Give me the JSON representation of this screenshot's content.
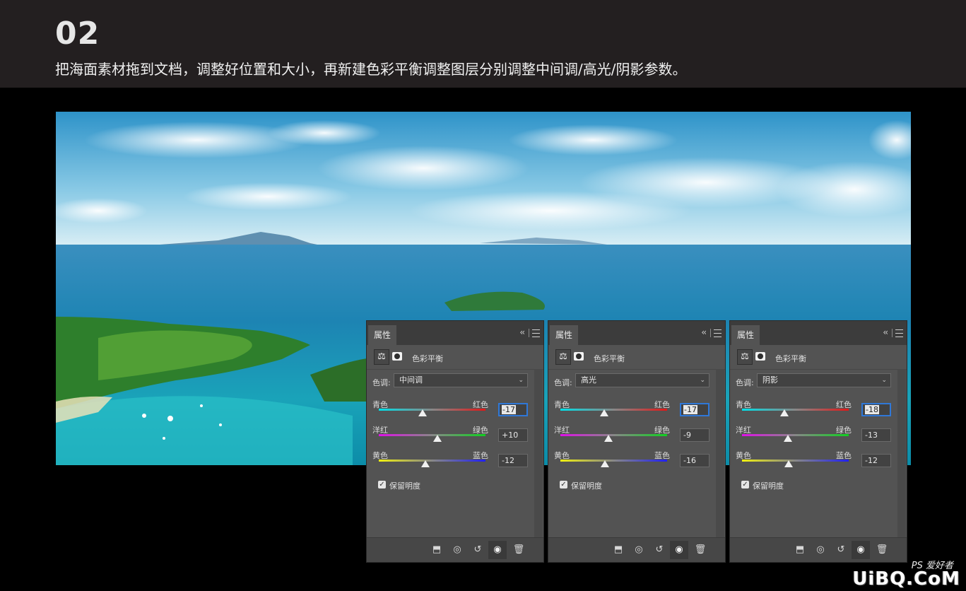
{
  "header": {
    "step": "02",
    "description": "把海面素材拖到文档，调整好位置和大小，再新建色彩平衡调整图层分别调整中间调/高光/阴影参数。"
  },
  "panels": [
    {
      "tab": "属性",
      "collapse": "‹‹",
      "adjustment": "色彩平衡",
      "tone_label": "色调:",
      "tone": "中间调",
      "sliders": [
        {
          "left": "青色",
          "right": "红色",
          "value": "-17",
          "level": 0.41
        },
        {
          "left": "洋红",
          "right": "绿色",
          "value": "+10",
          "level": 0.55
        },
        {
          "left": "黄色",
          "right": "蓝色",
          "value": "-12",
          "level": 0.44
        }
      ],
      "preserve_label": "保留明度",
      "preserve_checked": true
    },
    {
      "tab": "属性",
      "collapse": "‹‹",
      "adjustment": "色彩平衡",
      "tone_label": "色调:",
      "tone": "高光",
      "sliders": [
        {
          "left": "青色",
          "right": "红色",
          "value": "-17",
          "level": 0.41
        },
        {
          "left": "洋红",
          "right": "绿色",
          "value": "-9",
          "level": 0.45
        },
        {
          "left": "黄色",
          "right": "蓝色",
          "value": "-16",
          "level": 0.42
        }
      ],
      "preserve_label": "保留明度",
      "preserve_checked": true
    },
    {
      "tab": "属性",
      "collapse": "‹‹",
      "adjustment": "色彩平衡",
      "tone_label": "色调:",
      "tone": "阴影",
      "sliders": [
        {
          "left": "青色",
          "right": "红色",
          "value": "-18",
          "level": 0.4
        },
        {
          "left": "洋红",
          "right": "绿色",
          "value": "-13",
          "level": 0.43
        },
        {
          "left": "黄色",
          "right": "蓝色",
          "value": "-12",
          "level": 0.44
        }
      ],
      "preserve_label": "保留明度",
      "preserve_checked": true
    }
  ],
  "footer_icons": [
    "clip-to-layer-icon",
    "view-previous-icon",
    "reset-icon",
    "visibility-eye-icon",
    "trash-icon"
  ],
  "watermark": {
    "main": "UiBQ.CoM",
    "small": "PS 爱好者"
  },
  "colors": {
    "focus": "#2f78d8",
    "panel_bg": "#535353",
    "header_bg": "#231f20"
  }
}
